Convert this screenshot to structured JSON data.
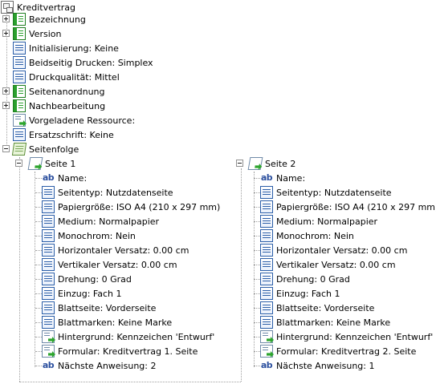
{
  "tree": {
    "root": "Kreditvertrag",
    "items": [
      {
        "label": "Bezeichnung"
      },
      {
        "label": "Version"
      },
      {
        "label": "Initialisierung:  Keine"
      },
      {
        "label": "Beidseitig Drucken:  Simplex"
      },
      {
        "label": "Druckqualität:  Mittel"
      },
      {
        "label": "Seitenanordnung"
      },
      {
        "label": "Nachbearbeitung"
      },
      {
        "label": "Vorgeladene Ressource:"
      },
      {
        "label": "Ersatzschrift:  Keine"
      },
      {
        "label": "Seitenfolge"
      }
    ],
    "pages": [
      {
        "title": "Seite 1",
        "props": [
          "Name:",
          "Seitentyp:  Nutzdatenseite",
          "Papiergröße:  ISO A4 (210 x 297 mm)",
          "Medium:  Normalpapier",
          "Monochrom:  Nein",
          "Horizontaler Versatz:  0.00 cm",
          "Vertikaler Versatz:  0.00 cm",
          "Drehung:  0 Grad",
          "Einzug:  Fach 1",
          "Blattseite:  Vorderseite",
          "Blattmarken:  Keine Marke",
          "Hintergrund:  Kennzeichen 'Entwurf'",
          "Formular:  Kreditvertrag 1. Seite",
          "Nächste Anweisung:  2"
        ]
      },
      {
        "title": "Seite 2",
        "props": [
          "Name:",
          "Seitentyp:  Nutzdatenseite",
          "Papiergröße:  ISO A4 (210 x 297 mm)",
          "Medium:  Normalpapier",
          "Monochrom:  Nein",
          "Horizontaler Versatz:  0.00 cm",
          "Vertikaler Versatz:  0.00 cm",
          "Drehung:  0 Grad",
          "Einzug:  Fach 1",
          "Blattseite:  Vorderseite",
          "Blattmarken:  Keine Marke",
          "Hintergrund:  Kennzeichen 'Entwurf'",
          "Formular:  Kreditvertrag 2. Seite",
          "Nächste Anweisung:  1"
        ]
      }
    ]
  },
  "icons": {
    "root": "document-tree-icon",
    "items": [
      "group-icon",
      "group-icon",
      "property-icon",
      "property-icon",
      "property-icon",
      "group-icon",
      "group-icon",
      "resource-icon",
      "property-icon",
      "page-sequence-icon"
    ],
    "page": "page-icon",
    "props": [
      "text-icon",
      "property-icon",
      "property-icon",
      "property-icon",
      "property-icon",
      "property-icon",
      "property-icon",
      "property-icon",
      "property-icon",
      "property-icon",
      "property-icon",
      "resource-icon",
      "resource-icon",
      "text-icon"
    ]
  },
  "colors": {
    "accent_green": "#2aa02d",
    "accent_blue": "#2b5ea8"
  }
}
